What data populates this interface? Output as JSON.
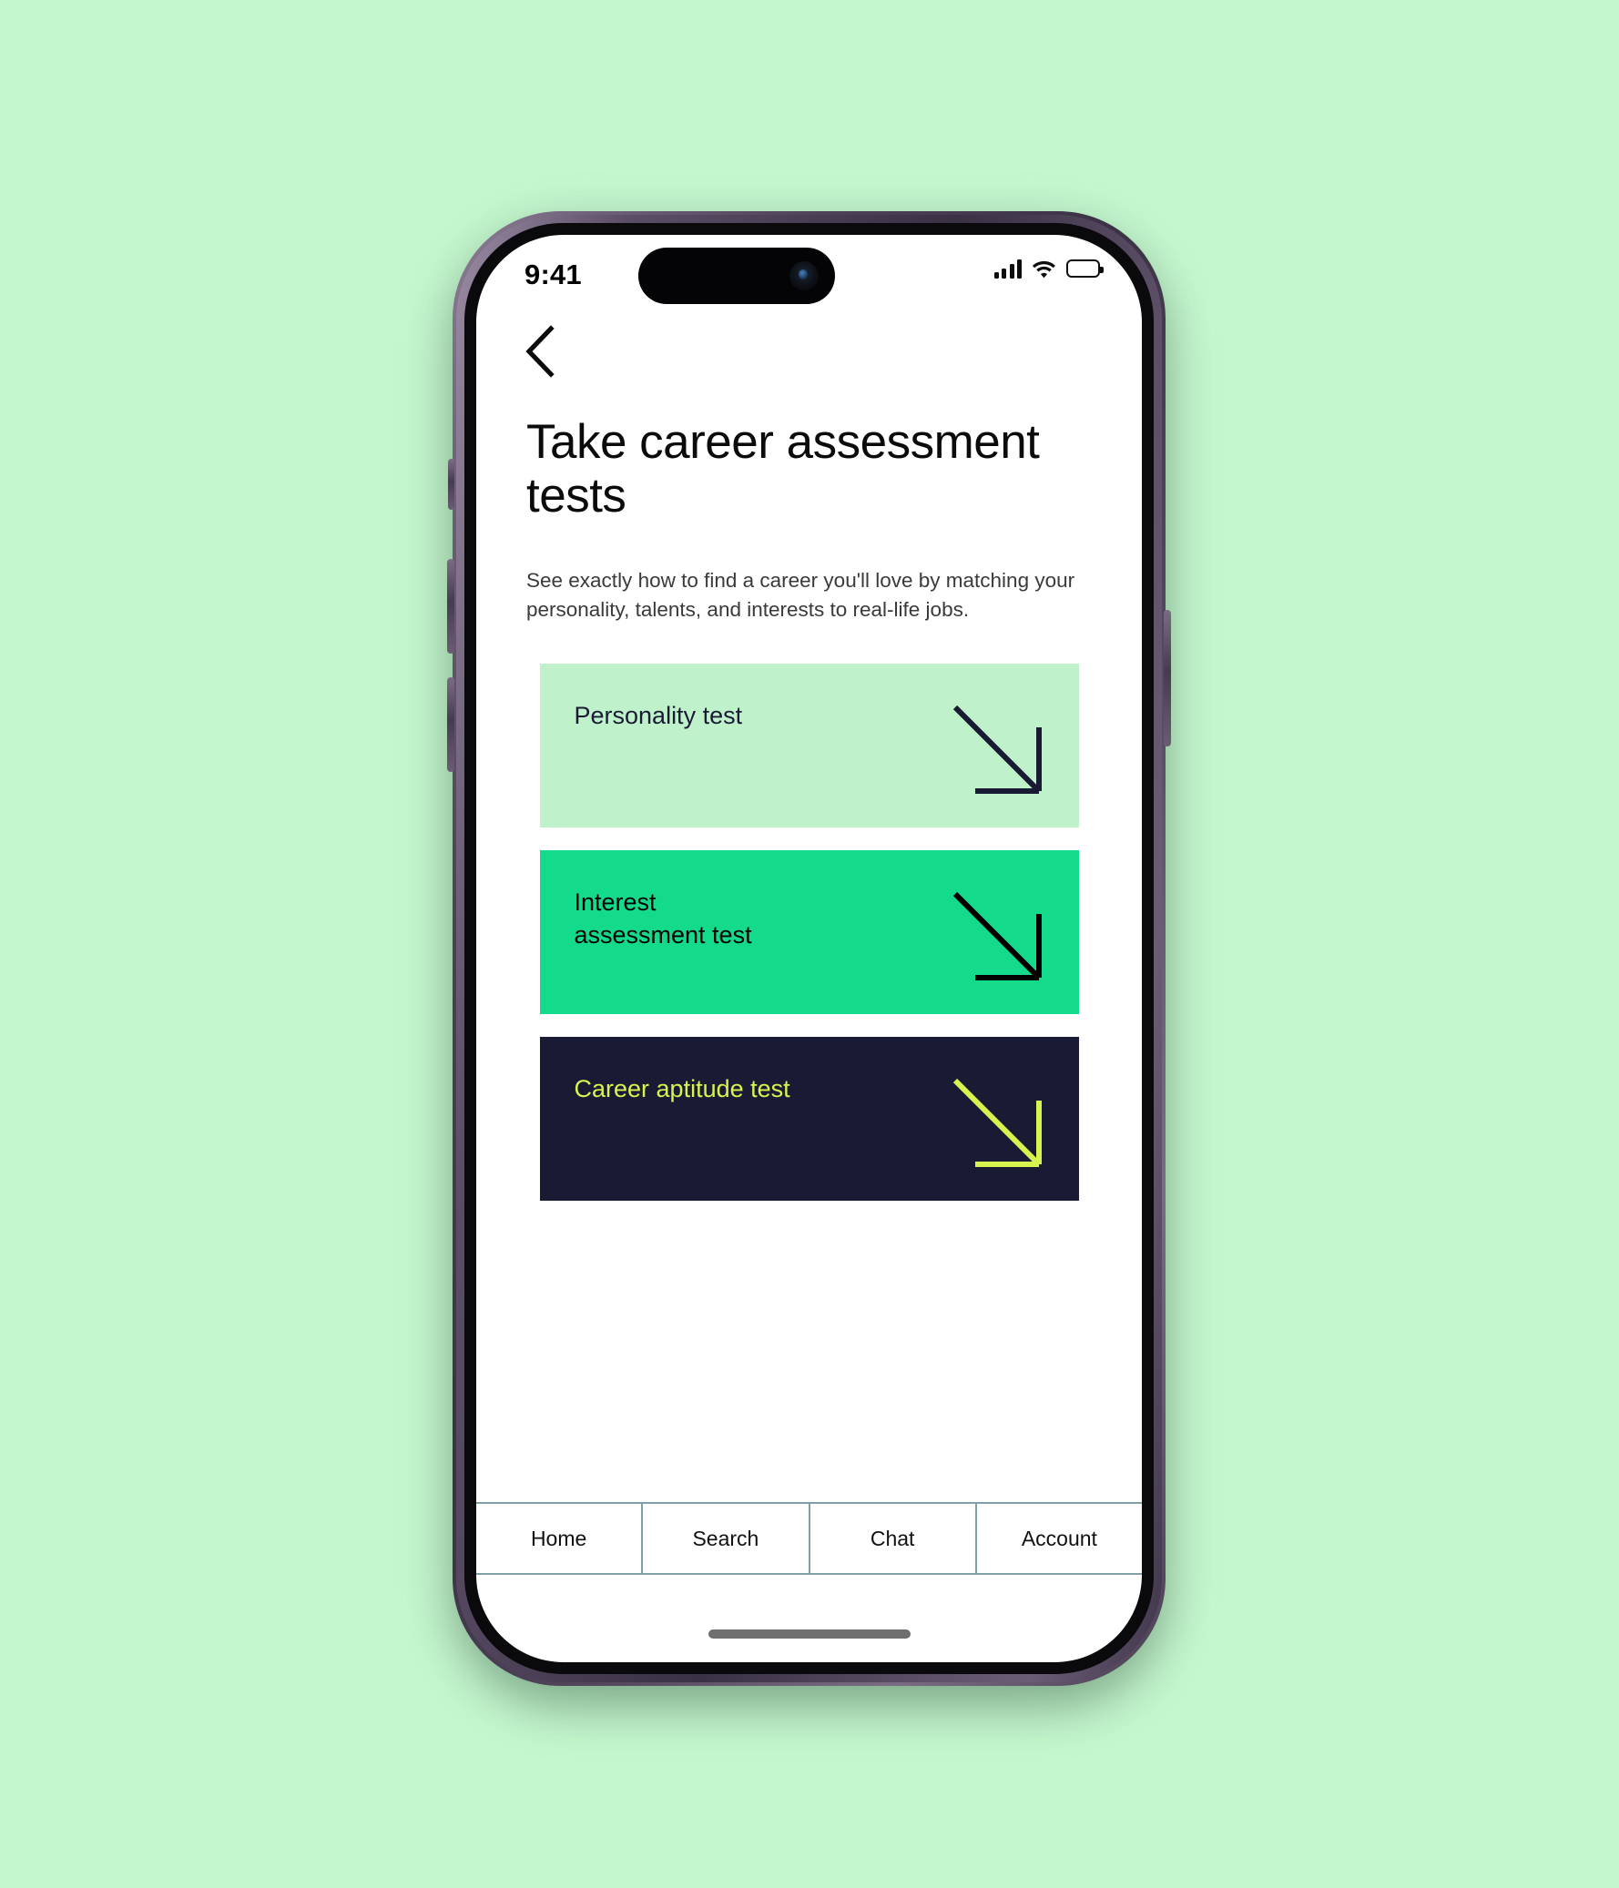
{
  "background_color": "#C4F7CE",
  "status_bar": {
    "time": "9:41",
    "signal_icon": "cellular-signal-icon",
    "wifi_icon": "wifi-icon",
    "battery_icon": "battery-full-icon"
  },
  "nav": {
    "back_icon": "chevron-left-icon"
  },
  "header": {
    "title": "Take career\nassessment tests",
    "description": "See exactly how to find a career you'll love by matching your personality, talents, and interests to real-life jobs."
  },
  "cards": [
    {
      "label": "Personality test",
      "bg_color": "#BFF2CB",
      "text_color": "#191B34",
      "arrow_color": "#191B34",
      "arrow_icon": "arrow-down-right-icon"
    },
    {
      "label": "Interest\nassessment test",
      "bg_color": "#14DB8C",
      "text_color": "#000000",
      "arrow_color": "#000000",
      "arrow_icon": "arrow-down-right-icon"
    },
    {
      "label": "Career aptitude test",
      "bg_color": "#191B34",
      "text_color": "#D8F34F",
      "arrow_color": "#D8F34F",
      "arrow_icon": "arrow-down-right-icon"
    }
  ],
  "tabbar": {
    "divider_color": "#7FA0A8",
    "items": [
      {
        "label": "Home"
      },
      {
        "label": "Search"
      },
      {
        "label": "Chat"
      },
      {
        "label": "Account"
      }
    ]
  },
  "home_indicator": {
    "color": "#6e6e6e"
  }
}
